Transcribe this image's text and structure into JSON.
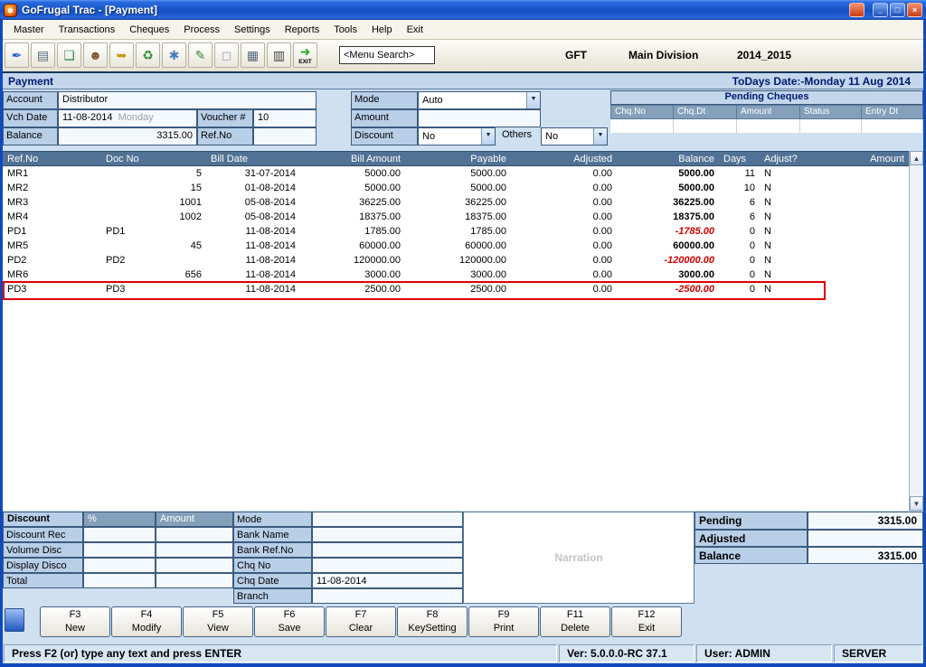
{
  "window": {
    "title": "GoFrugal Trac - [Payment]"
  },
  "menu": {
    "items": [
      "Master",
      "Transactions",
      "Cheques",
      "Process",
      "Settings",
      "Reports",
      "Tools",
      "Help",
      "Exit"
    ]
  },
  "toolbar": {
    "search_value": "<Menu Search>",
    "company": "GFT",
    "division": "Main Division",
    "financial_year": "2014_2015",
    "exit_label": "EXIT",
    "icons": [
      {
        "name": "new-voucher-icon",
        "glyph": "✒",
        "color": "#2a5fd0"
      },
      {
        "name": "save-icon",
        "glyph": "▤",
        "color": "#5a6a7a"
      },
      {
        "name": "browse-icon",
        "glyph": "❏",
        "color": "#2e8b57"
      },
      {
        "name": "accounts-icon",
        "glyph": "☻",
        "color": "#7a5230"
      },
      {
        "name": "import-icon",
        "glyph": "➥",
        "color": "#c79810"
      },
      {
        "name": "refresh-icon",
        "glyph": "♻",
        "color": "#2e8b2e"
      },
      {
        "name": "process-icon",
        "glyph": "✱",
        "color": "#4a7ab5"
      },
      {
        "name": "edit-icon",
        "glyph": "✎",
        "color": "#3a8a3a"
      },
      {
        "name": "blank-icon",
        "glyph": "◻",
        "color": "#9aa8b8"
      },
      {
        "name": "grid-icon",
        "glyph": "▦",
        "color": "#5a6a7a"
      },
      {
        "name": "print-icon",
        "glyph": "▥",
        "color": "#444444"
      },
      {
        "name": "exit-icon",
        "glyph": "➜",
        "color": "#1faf1f",
        "label": "EXIT"
      }
    ]
  },
  "payment_header": {
    "title": "Payment",
    "date": "ToDays Date:-Monday 11 Aug 2014"
  },
  "form": {
    "account_label": "Account",
    "account_value": "Distributor",
    "vch_date_label": "Vch Date",
    "vch_date_value": "11-08-2014",
    "vch_day": "Monday",
    "voucher_label": "Voucher #",
    "voucher_value": "10",
    "balance_label": "Balance",
    "balance_value": "3315.00",
    "refno_label": "Ref.No",
    "refno_value": "",
    "mode_label": "Mode",
    "mode_value": "Auto",
    "amount_label": "Amount",
    "amount_value": "",
    "discount_label": "Discount",
    "discount_value": "No",
    "others_label": "Others",
    "others_value": "No"
  },
  "pending_cheques": {
    "title": "Pending Cheques",
    "columns": [
      "Chq.No",
      "Chq.Dt",
      "Amount",
      "Status",
      "Entry Dt"
    ]
  },
  "table": {
    "columns": [
      "Ref.No",
      "Doc No",
      "Bill Date",
      "Bill Amount",
      "Payable",
      "Adjusted",
      "Balance",
      "Days",
      "Adjust?",
      "Amount"
    ],
    "rows": [
      {
        "ref": "MR1",
        "doc": "5",
        "date": "31-07-2014",
        "bill": "5000.00",
        "payable": "5000.00",
        "adjusted": "0.00",
        "balance": "5000.00",
        "days": "11",
        "adjust": "N",
        "amount": "",
        "neg": false,
        "highlight": false
      },
      {
        "ref": "MR2",
        "doc": "15",
        "date": "01-08-2014",
        "bill": "5000.00",
        "payable": "5000.00",
        "adjusted": "0.00",
        "balance": "5000.00",
        "days": "10",
        "adjust": "N",
        "amount": "",
        "neg": false,
        "highlight": false
      },
      {
        "ref": "MR3",
        "doc": "1001",
        "date": "05-08-2014",
        "bill": "36225.00",
        "payable": "36225.00",
        "adjusted": "0.00",
        "balance": "36225.00",
        "days": "6",
        "adjust": "N",
        "amount": "",
        "neg": false,
        "highlight": false
      },
      {
        "ref": "MR4",
        "doc": "1002",
        "date": "05-08-2014",
        "bill": "18375.00",
        "payable": "18375.00",
        "adjusted": "0.00",
        "balance": "18375.00",
        "days": "6",
        "adjust": "N",
        "amount": "",
        "neg": false,
        "highlight": false
      },
      {
        "ref": "PD1",
        "doc": "PD1",
        "date": "11-08-2014",
        "bill": "1785.00",
        "payable": "1785.00",
        "adjusted": "0.00",
        "balance": "-1785.00",
        "days": "0",
        "adjust": "N",
        "amount": "",
        "neg": true,
        "highlight": false
      },
      {
        "ref": "MR5",
        "doc": "45",
        "date": "11-08-2014",
        "bill": "60000.00",
        "payable": "60000.00",
        "adjusted": "0.00",
        "balance": "60000.00",
        "days": "0",
        "adjust": "N",
        "amount": "",
        "neg": false,
        "highlight": false
      },
      {
        "ref": "PD2",
        "doc": "PD2",
        "date": "11-08-2014",
        "bill": "120000.00",
        "payable": "120000.00",
        "adjusted": "0.00",
        "balance": "-120000.00",
        "days": "0",
        "adjust": "N",
        "amount": "",
        "neg": true,
        "highlight": false
      },
      {
        "ref": "MR6",
        "doc": "656",
        "date": "11-08-2014",
        "bill": "3000.00",
        "payable": "3000.00",
        "adjusted": "0.00",
        "balance": "3000.00",
        "days": "0",
        "adjust": "N",
        "amount": "",
        "neg": false,
        "highlight": false
      },
      {
        "ref": "PD3",
        "doc": "PD3",
        "date": "11-08-2014",
        "bill": "2500.00",
        "payable": "2500.00",
        "adjusted": "0.00",
        "balance": "-2500.00",
        "days": "0",
        "adjust": "N",
        "amount": "",
        "neg": true,
        "highlight": true
      }
    ]
  },
  "bottom": {
    "discount_table": {
      "corner": "Discount",
      "col_percent": "%",
      "col_amount": "Amount",
      "rows": [
        "Discount Rec",
        "Volume Disc",
        "Display Disco",
        "Total"
      ]
    },
    "bank": {
      "rows": [
        {
          "label": "Mode",
          "value": ""
        },
        {
          "label": "Bank Name",
          "value": ""
        },
        {
          "label": "Bank Ref.No",
          "value": ""
        },
        {
          "label": "Chq No",
          "value": ""
        },
        {
          "label": "Chq Date",
          "value": "11-08-2014"
        },
        {
          "label": "Branch",
          "value": ""
        }
      ]
    },
    "narration_placeholder": "Narration",
    "totals": [
      {
        "label": "Pending",
        "value": "3315.00"
      },
      {
        "label": "Adjusted",
        "value": ""
      },
      {
        "label": "Balance",
        "value": "3315.00"
      }
    ]
  },
  "function_keys": [
    {
      "key": "F3",
      "label": "New"
    },
    {
      "key": "F4",
      "label": "Modify"
    },
    {
      "key": "F5",
      "label": "View"
    },
    {
      "key": "F6",
      "label": "Save"
    },
    {
      "key": "F7",
      "label": "Clear"
    },
    {
      "key": "F8",
      "label": "KeySetting"
    },
    {
      "key": "F9",
      "label": "Print"
    },
    {
      "key": "F11",
      "label": "Delete"
    },
    {
      "key": "F12",
      "label": "Exit"
    }
  ],
  "statusbar": {
    "hint": "Press F2 (or) type any text and press ENTER",
    "version": "Ver: 5.0.0.0-RC 37.1",
    "user": "User: ADMIN",
    "server": "SERVER"
  }
}
